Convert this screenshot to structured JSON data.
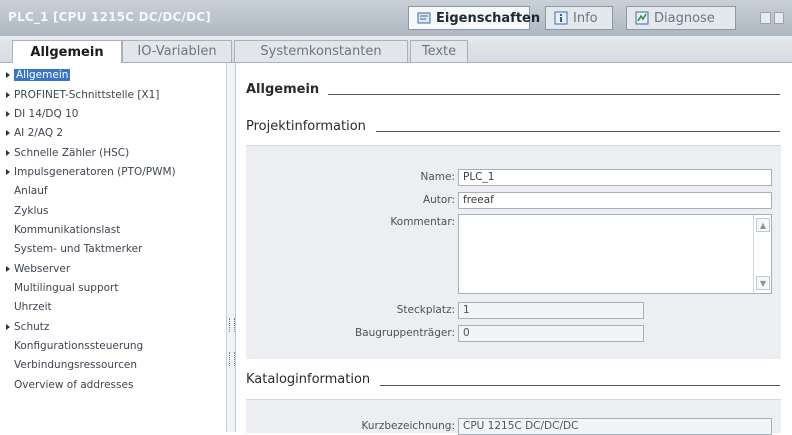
{
  "window": {
    "title": "PLC_1 [CPU 1215C DC/DC/DC]",
    "tabs": [
      {
        "label": "Eigenschaften",
        "icon": "properties-icon"
      },
      {
        "label": "Info",
        "icon": "info-icon"
      },
      {
        "label": "Diagnose",
        "icon": "diagnostics-icon"
      }
    ]
  },
  "subtabs": [
    "Allgemein",
    "IO-Variablen",
    "Systemkonstanten",
    "Texte"
  ],
  "nav": {
    "items": [
      {
        "label": "Allgemein",
        "expandable": true,
        "selected": true
      },
      {
        "label": "PROFINET-Schnittstelle [X1]",
        "expandable": true
      },
      {
        "label": "DI 14/DQ 10",
        "expandable": true
      },
      {
        "label": "AI 2/AQ 2",
        "expandable": true
      },
      {
        "label": "Schnelle Zähler (HSC)",
        "expandable": true
      },
      {
        "label": "Impulsgeneratoren (PTO/PWM)",
        "expandable": true
      },
      {
        "label": "Anlauf",
        "expandable": false
      },
      {
        "label": "Zyklus",
        "expandable": false
      },
      {
        "label": "Kommunikationslast",
        "expandable": false
      },
      {
        "label": "System- und Taktmerker",
        "expandable": false
      },
      {
        "label": "Webserver",
        "expandable": true
      },
      {
        "label": "Multilingual support",
        "expandable": false
      },
      {
        "label": "Uhrzeit",
        "expandable": false
      },
      {
        "label": "Schutz",
        "expandable": true
      },
      {
        "label": "Konfigurationssteuerung",
        "expandable": false
      },
      {
        "label": "Verbindungsressourcen",
        "expandable": false
      },
      {
        "label": "Overview of addresses",
        "expandable": false
      }
    ]
  },
  "content": {
    "section_title": "Allgemein",
    "projekt": {
      "title": "Projektinformation",
      "name_label": "Name:",
      "name_value": "PLC_1",
      "autor_label": "Autor:",
      "autor_value": "freeaf",
      "kommentar_label": "Kommentar:",
      "kommentar_value": "",
      "steckplatz_label": "Steckplatz:",
      "steckplatz_value": "1",
      "baugruppentraeger_label": "Baugruppenträger:",
      "baugruppentraeger_value": "0"
    },
    "katalog": {
      "title": "Kataloginformation",
      "kurzbezeichnung_label": "Kurzbezeichnung:",
      "kurzbezeichnung_value": "CPU 1215C DC/DC/DC"
    }
  }
}
